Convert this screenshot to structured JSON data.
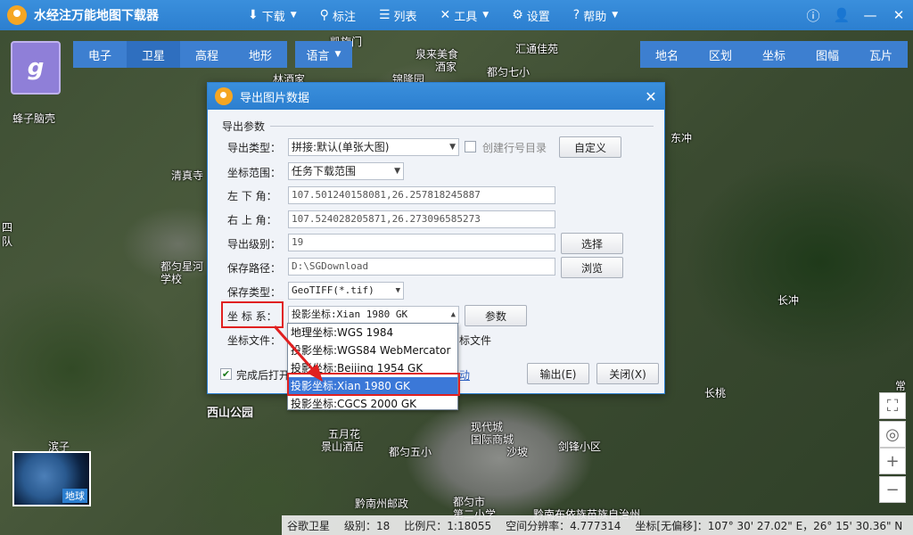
{
  "app": {
    "title": "水经注万能地图下载器"
  },
  "menu": [
    {
      "label": "下载",
      "icon": "download-icon",
      "glyph": "⬇",
      "caret": true
    },
    {
      "label": "标注",
      "icon": "pin-icon",
      "glyph": "⚲",
      "caret": false
    },
    {
      "label": "列表",
      "icon": "list-icon",
      "glyph": "☰",
      "caret": false
    },
    {
      "label": "工具",
      "icon": "tools-icon",
      "glyph": "✕",
      "caret": true
    },
    {
      "label": "设置",
      "icon": "gear-icon",
      "glyph": "⚙",
      "caret": false
    },
    {
      "label": "帮助",
      "icon": "help-icon",
      "glyph": "?",
      "caret": true
    }
  ],
  "window_controls": [
    "info-icon",
    "user-icon",
    "minimize-icon",
    "close-icon"
  ],
  "map_types": [
    {
      "label": "电子",
      "active": false
    },
    {
      "label": "卫星",
      "active": true
    },
    {
      "label": "高程",
      "active": false
    },
    {
      "label": "地形",
      "active": false
    }
  ],
  "language": {
    "label": "语言"
  },
  "right_tools": [
    {
      "label": "地名"
    },
    {
      "label": "区划"
    },
    {
      "label": "坐标"
    },
    {
      "label": "图幅"
    },
    {
      "label": "瓦片"
    }
  ],
  "map_labels": [
    {
      "text": "凯旋门",
      "big": false
    },
    {
      "text": "汇通佳苑",
      "big": false
    },
    {
      "text": "泉来美食",
      "big": false
    },
    {
      "text": "酒家",
      "big": false
    },
    {
      "text": "都匀七小",
      "big": false
    },
    {
      "text": "锦隆园",
      "big": false
    },
    {
      "text": "林酒家",
      "big": false
    },
    {
      "text": "蜂子脑壳",
      "big": false
    },
    {
      "text": "清真寺",
      "big": false
    },
    {
      "text": "四",
      "big": false
    },
    {
      "text": "队",
      "big": false
    },
    {
      "text": "都匀星河",
      "big": false
    },
    {
      "text": "学校",
      "big": false
    },
    {
      "text": "东冲",
      "big": false
    },
    {
      "text": "长冲",
      "big": false
    },
    {
      "text": "长桃",
      "big": false
    },
    {
      "text": "西山公园",
      "big": true
    },
    {
      "text": "现代城",
      "big": false
    },
    {
      "text": "国际商城",
      "big": false
    },
    {
      "text": "五月花",
      "big": false
    },
    {
      "text": "景山酒店",
      "big": false
    },
    {
      "text": "都匀五小",
      "big": false
    },
    {
      "text": "沙坡",
      "big": false
    },
    {
      "text": "剑锋小区",
      "big": false
    },
    {
      "text": "黔南州邮政",
      "big": false
    },
    {
      "text": "都匀市",
      "big": false
    },
    {
      "text": "第二小学",
      "big": false
    },
    {
      "text": "黔南布依族苗族自治州",
      "big": false
    },
    {
      "text": "常",
      "big": false
    },
    {
      "text": "滨子",
      "big": false
    }
  ],
  "globe": {
    "label": "地球"
  },
  "statusbar": {
    "source": "谷歌卫星",
    "level": "级别：18",
    "scale": "比例尺：1:18055",
    "resolution": "空间分辨率：4.777314",
    "coords": "坐标[无偏移]：107° 30' 27.02\" E，26° 15' 30.36\" N"
  },
  "dialog": {
    "title": "导出图片数据",
    "section": "导出参数",
    "export_type": {
      "label": "导出类型：",
      "value": "拼接:默认(单张大图)"
    },
    "create_rowcol": {
      "label": "创建行号目录",
      "checked": false
    },
    "customize": "自定义",
    "range": {
      "label": "坐标范围：",
      "value": "任务下载范围"
    },
    "lower_left": {
      "label": "左 下 角：",
      "value": "107.501240158081,26.257818245887"
    },
    "upper_right": {
      "label": "右 上 角：",
      "value": "107.524028205871,26.273096585273"
    },
    "level": {
      "label": "导出级别：",
      "value": "19"
    },
    "select_btn": "选择",
    "save_path": {
      "label": "保存路径：",
      "value": "D:\\SGDownload"
    },
    "browse_btn": "浏览",
    "save_type": {
      "label": "保存类型：",
      "value": "GeoTIFF(*.tif)"
    },
    "coord_sys": {
      "label": "坐 标 系：",
      "value": "投影坐标:Xian 1980 GK"
    },
    "params_btn": "参数",
    "coord_file": {
      "label": "坐标文件：",
      "suffix": "标文件"
    },
    "open_after": {
      "label": "完成后打开",
      "checked": true
    },
    "link_fragment": "动",
    "export_btn": "输出(E)",
    "close_btn": "关闭(X)",
    "options": [
      {
        "label": "地理坐标:WGS 1984",
        "selected": false
      },
      {
        "label": "投影坐标:WGS84 WebMercator",
        "selected": false
      },
      {
        "label": "投影坐标:Beijing 1954 GK",
        "selected": false
      },
      {
        "label": "投影坐标:Xian 1980 GK",
        "selected": true
      },
      {
        "label": "投影坐标:CGCS 2000 GK",
        "selected": false
      }
    ]
  },
  "colors": {
    "titlebar": "#2c7fd0",
    "toolbar": "#3d7fd0",
    "highlight": "#e02020",
    "selected": "#3b78d8"
  }
}
